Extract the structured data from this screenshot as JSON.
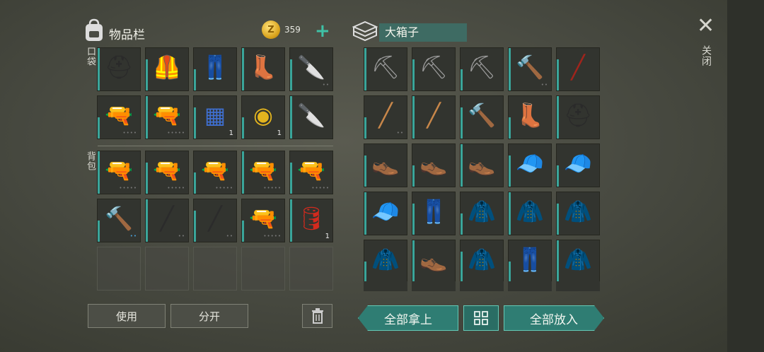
{
  "inventory": {
    "title": "物品栏",
    "coins": "359",
    "pockets_label": "口袋",
    "backpack_label": "背包",
    "pocket_items": [
      {
        "icon": "helmet-icon",
        "glyph": "⛑",
        "color": "#2a2a2a",
        "dots": ""
      },
      {
        "icon": "armor-vest-icon",
        "glyph": "🦺",
        "color": "#2e3850",
        "dots": ""
      },
      {
        "icon": "tactical-pants-icon",
        "glyph": "👖",
        "color": "#2c3446",
        "dots": ""
      },
      {
        "icon": "boots-icon",
        "glyph": "👢",
        "color": "#1e1e1e",
        "dots": ""
      },
      {
        "icon": "cleaver-icon",
        "glyph": "🔪",
        "color": "#b8b8b8",
        "dots": "••"
      },
      {
        "icon": "shotgun-icon",
        "glyph": "🔫",
        "color": "#6b4c2e",
        "dots": "••••"
      },
      {
        "icon": "assault-rifle-icon",
        "glyph": "🔫",
        "color": "#8a4e22",
        "dots": "•••••"
      },
      {
        "icon": "circuit-board-icon",
        "glyph": "▦",
        "color": "#3f6fd0",
        "qty": "1"
      },
      {
        "icon": "filter-icon",
        "glyph": "◉",
        "color": "#e3b41e",
        "qty": "1"
      },
      {
        "icon": "cleaver-icon",
        "glyph": "🔪",
        "color": "#c0c0c0",
        "dots": ""
      }
    ],
    "backpack_items": [
      {
        "icon": "pistol-icon",
        "glyph": "🔫",
        "color": "#3a3d44",
        "dots": "•••••"
      },
      {
        "icon": "pistol-icon",
        "glyph": "🔫",
        "color": "#3a3d44",
        "dots": "•••••"
      },
      {
        "icon": "pistol-icon",
        "glyph": "🔫",
        "color": "#3a3d44",
        "dots": "•••••"
      },
      {
        "icon": "pistol-icon",
        "glyph": "🔫",
        "color": "#3a3d44",
        "dots": "•••••"
      },
      {
        "icon": "pistol-icon",
        "glyph": "🔫",
        "color": "#3a3d44",
        "dots": "•••••"
      },
      {
        "icon": "sledgehammer-icon",
        "glyph": "🔨",
        "color": "#8ab6d8",
        "dots": "••",
        "dots_color": "blue"
      },
      {
        "icon": "crowbar-icon",
        "glyph": "╱",
        "color": "#2b2b2b",
        "dots": "••"
      },
      {
        "icon": "crowbar-icon",
        "glyph": "╱",
        "color": "#2b2b2b",
        "dots": "••"
      },
      {
        "icon": "pistol-icon",
        "glyph": "🔫",
        "color": "#3a3d44",
        "dots": "•••••"
      },
      {
        "icon": "oil-can-icon",
        "glyph": "🛢",
        "color": "#d22a1e",
        "qty": "1"
      },
      {
        "icon": "",
        "glyph": "",
        "empty": true
      },
      {
        "icon": "",
        "glyph": "",
        "empty": true
      },
      {
        "icon": "",
        "glyph": "",
        "empty": true
      },
      {
        "icon": "",
        "glyph": "",
        "empty": true
      },
      {
        "icon": "",
        "glyph": "",
        "empty": true
      }
    ],
    "use_label": "使用",
    "split_label": "分开",
    "trash_icon": "trash-icon"
  },
  "chest": {
    "name": "大箱子",
    "items": [
      {
        "icon": "pickaxe-icon",
        "glyph": "⛏",
        "color": "#9a9a9a",
        "dots": ""
      },
      {
        "icon": "pickaxe-icon",
        "glyph": "⛏",
        "color": "#9a9a9a",
        "dots": ""
      },
      {
        "icon": "pickaxe-icon",
        "glyph": "⛏",
        "color": "#9a9a9a",
        "dots": ""
      },
      {
        "icon": "sledgehammer-icon",
        "glyph": "🔨",
        "color": "#8ab6d8",
        "dots": "••"
      },
      {
        "icon": "crowbar-icon",
        "glyph": "╱",
        "color": "#a0241c",
        "dots": ""
      },
      {
        "icon": "baseball-bat-icon",
        "glyph": "╱",
        "color": "#c8874a",
        "dots": "••"
      },
      {
        "icon": "baseball-bat-icon",
        "glyph": "╱",
        "color": "#c8874a",
        "dots": ""
      },
      {
        "icon": "hammer-icon",
        "glyph": "🔨",
        "color": "#e8d23a",
        "dots": ""
      },
      {
        "icon": "boots-icon",
        "glyph": "👢",
        "color": "#1e1e1e",
        "dots": ""
      },
      {
        "icon": "helmet-icon",
        "glyph": "⛑",
        "color": "#2a2a2a",
        "dots": ""
      },
      {
        "icon": "shoes-icon",
        "glyph": "👞",
        "color": "#8a6a3c",
        "dots": ""
      },
      {
        "icon": "shoes-icon",
        "glyph": "👞",
        "color": "#8a6a3c",
        "dots": ""
      },
      {
        "icon": "shoes-icon",
        "glyph": "👞",
        "color": "#8a6a3c",
        "dots": ""
      },
      {
        "icon": "camo-cap-icon",
        "glyph": "🧢",
        "color": "#6f7d3a",
        "dots": ""
      },
      {
        "icon": "camo-cap-icon",
        "glyph": "🧢",
        "color": "#6f7d3a",
        "dots": ""
      },
      {
        "icon": "camo-cap-icon",
        "glyph": "🧢",
        "color": "#6f7d3a",
        "dots": ""
      },
      {
        "icon": "camo-pants-icon",
        "glyph": "👖",
        "color": "#6a6a3a",
        "dots": ""
      },
      {
        "icon": "camo-jacket-icon",
        "glyph": "🧥",
        "color": "#5e6a36",
        "dots": ""
      },
      {
        "icon": "camo-jacket-icon",
        "glyph": "🧥",
        "color": "#5e6a36",
        "dots": ""
      },
      {
        "icon": "camo-jacket-icon",
        "glyph": "🧥",
        "color": "#5e6a36",
        "dots": ""
      },
      {
        "icon": "camo-jacket-icon",
        "glyph": "🧥",
        "color": "#5e6a36",
        "dots": ""
      },
      {
        "icon": "leather-boots-icon",
        "glyph": "👞",
        "color": "#7a3a2a",
        "dots": ""
      },
      {
        "icon": "leather-jacket-icon",
        "glyph": "🧥",
        "color": "#6b4a32",
        "dots": ""
      },
      {
        "icon": "jeans-icon",
        "glyph": "👖",
        "color": "#7a98b8",
        "dots": ""
      },
      {
        "icon": "bomber-jacket-icon",
        "glyph": "🧥",
        "color": "#5e5434",
        "dots": ""
      }
    ],
    "take_all_label": "全部拿上",
    "sort_icon": "grid-sort-icon",
    "put_all_label": "全部放入"
  },
  "close_label": "关闭",
  "colors": {
    "accent": "#3fc1a6",
    "panel_dark": "#32342f"
  }
}
